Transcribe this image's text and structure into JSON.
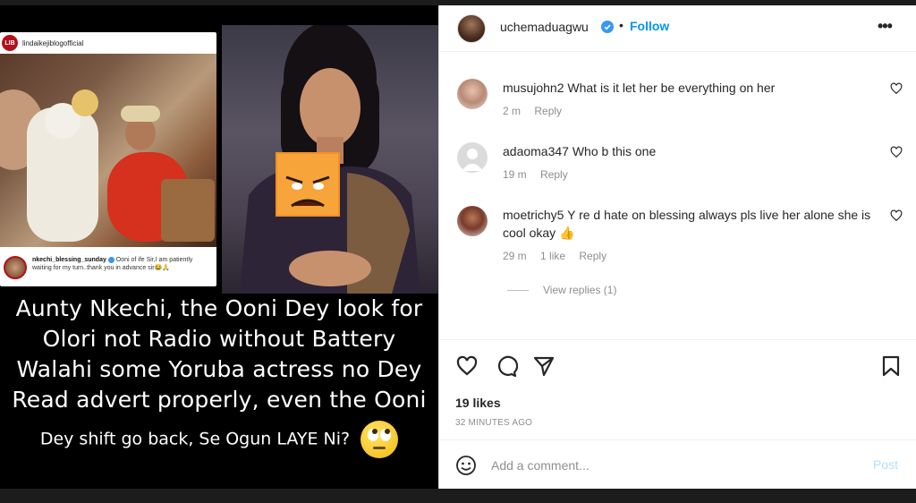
{
  "media": {
    "inset": {
      "logo_text": "LIB",
      "handle": "lindaikejiblogofficial",
      "comment_user": "nkechi_blessing_sunday",
      "comment_text": "Ooni of ife Sir,I am patiently waiting for my turn..thank you in advance sir😂🙏"
    },
    "caption_lines": [
      "Aunty Nkechi, the Ooni Dey look for",
      "Olori not Radio without Battery",
      "Walahi some Yoruba actress no Dey",
      "Read advert properly, even the Ooni"
    ],
    "caption_last": "Dey shift go back, Se Ogun LAYE Ni?"
  },
  "post": {
    "author": "uchemaduagwu",
    "dot": "•",
    "follow_label": "Follow",
    "more_label": "•••"
  },
  "comments": [
    {
      "user": "musujohn2",
      "text": "What is it let her be everything on her",
      "time": "2 m",
      "likes": "",
      "reply": "Reply"
    },
    {
      "user": "adaoma347",
      "text": "Who b this one",
      "time": "19 m",
      "likes": "",
      "reply": "Reply"
    },
    {
      "user": "moetrichy5",
      "text": "Y re d hate on blessing always pls live her alone she is cool okay 👍",
      "time": "29 m",
      "likes": "1 like",
      "reply": "Reply"
    }
  ],
  "view_replies": "View replies (1)",
  "likes": "19 likes",
  "time_ago": "32 MINUTES AGO",
  "comment_placeholder": "Add a comment...",
  "post_label": "Post",
  "colors": {
    "link_blue": "#0095f6",
    "post_disabled": "#b2dffc",
    "muted": "#8e8e8e"
  }
}
